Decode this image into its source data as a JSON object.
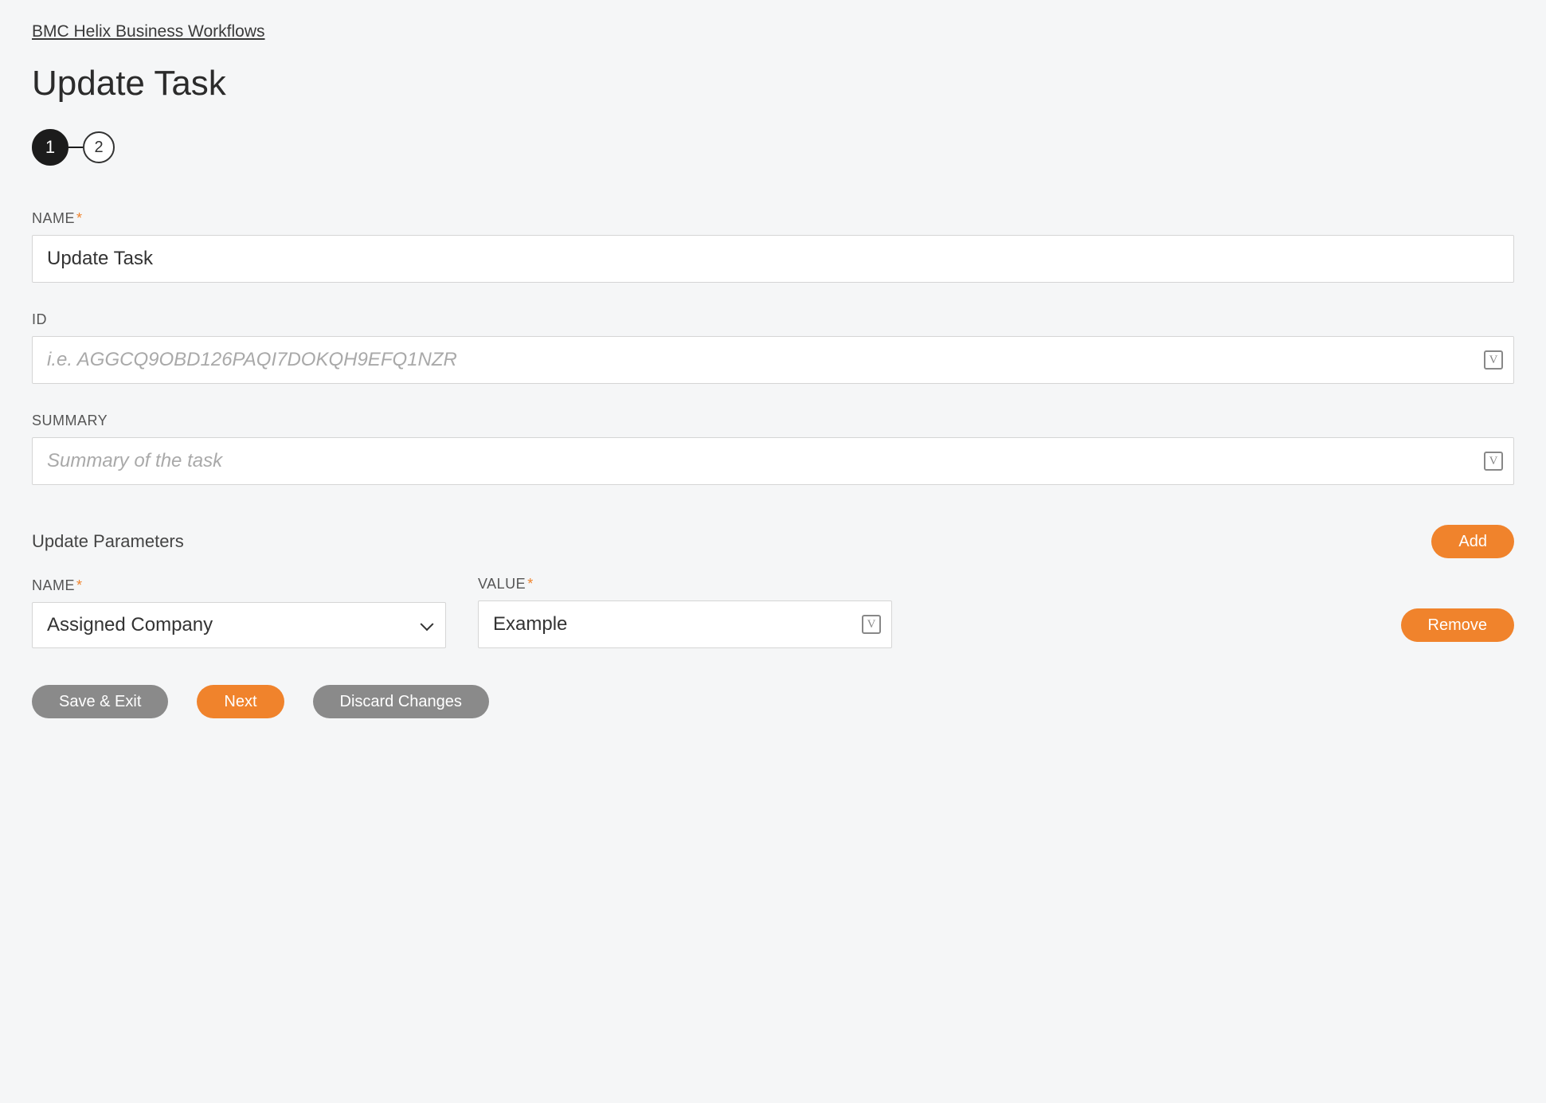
{
  "breadcrumb": "BMC Helix Business Workflows",
  "page_title": "Update Task",
  "stepper": {
    "step1": "1",
    "step2": "2"
  },
  "fields": {
    "name": {
      "label": "NAME",
      "value": "Update Task",
      "required": true
    },
    "id": {
      "label": "ID",
      "placeholder": "i.e. AGGCQ9OBD126PAQI7DOKQH9EFQ1NZR",
      "value": "",
      "required": false
    },
    "summary": {
      "label": "SUMMARY",
      "placeholder": "Summary of the task",
      "value": "",
      "required": false
    }
  },
  "update_params": {
    "section_title": "Update Parameters",
    "add_label": "Add",
    "rows": [
      {
        "name_label": "NAME",
        "name_value": "Assigned Company",
        "value_label": "VALUE",
        "value_value": "Example",
        "remove_label": "Remove"
      }
    ]
  },
  "footer": {
    "save_exit": "Save & Exit",
    "next": "Next",
    "discard": "Discard Changes"
  },
  "var_icon_glyph": "V"
}
